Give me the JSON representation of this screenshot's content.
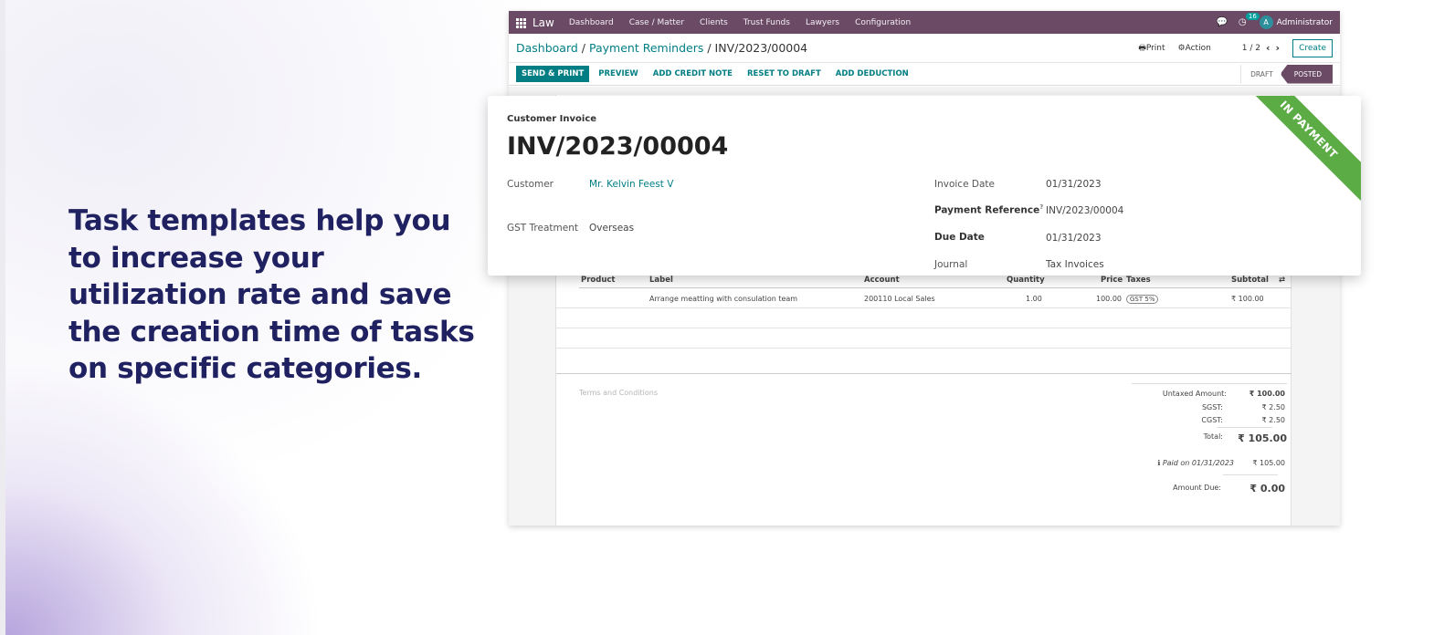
{
  "headline": "Task templates help you to increase your utilization rate and save the creation time of tasks on specific categories.",
  "navbar": {
    "brand": "Law",
    "items": [
      "Dashboard",
      "Case / Matter",
      "Clients",
      "Trust Funds",
      "Lawyers",
      "Configuration"
    ],
    "notification_count": "16",
    "avatar_letter": "A",
    "user": "Administrator"
  },
  "control": {
    "breadcrumb": [
      "Dashboard",
      "Payment Reminders",
      "INV/2023/00004"
    ],
    "separator": " / ",
    "print": "Print",
    "action": "Action",
    "pager": "1 / 2",
    "create": "Create"
  },
  "statusbar": {
    "primary": "SEND & PRINT",
    "buttons": [
      "PREVIEW",
      "ADD CREDIT NOTE",
      "RESET TO DRAFT",
      "ADD DEDUCTION"
    ],
    "stages": [
      "DRAFT",
      "POSTED"
    ],
    "active_stage": "POSTED"
  },
  "invoice": {
    "type": "Customer Invoice",
    "number": "INV/2023/00004",
    "ribbon": "IN PAYMENT",
    "customer_label": "Customer",
    "customer": "Mr. Kelvin Feest V",
    "gst_label": "GST Treatment",
    "gst": "Overseas",
    "date_label": "Invoice Date",
    "date": "01/31/2023",
    "payref_label": "Payment Reference",
    "payref_tooltip": "?",
    "payref": "INV/2023/00004",
    "due_label": "Due Date",
    "due": "01/31/2023",
    "journal_label": "Journal",
    "journal": "Tax Invoices"
  },
  "lines": {
    "headers": {
      "product": "Product",
      "label": "Label",
      "account": "Account",
      "quantity": "Quantity",
      "price": "Price",
      "taxes": "Taxes",
      "subtotal": "Subtotal"
    },
    "rows": [
      {
        "label": "Arrange meatting with consulation team",
        "account": "200110 Local Sales",
        "quantity": "1.00",
        "price": "100.00",
        "taxes": "GST 5%",
        "subtotal": "₹ 100.00"
      }
    ]
  },
  "terms": "Terms and Conditions",
  "totals": {
    "untaxed_label": "Untaxed Amount:",
    "untaxed": "₹ 100.00",
    "sgst_label": "SGST:",
    "sgst": "₹ 2.50",
    "cgst_label": "CGST:",
    "cgst": "₹ 2.50",
    "total_label": "Total:",
    "total": "₹ 105.00",
    "paid_label": "Paid on 01/31/2023",
    "paid": "₹ 105.00",
    "due_label": "Amount Due:",
    "due": "₹ 0.00"
  },
  "colors": {
    "navbar": "#6b4a66",
    "accent": "#017e84",
    "ribbon": "#5cac46",
    "headline": "#1f2160"
  }
}
